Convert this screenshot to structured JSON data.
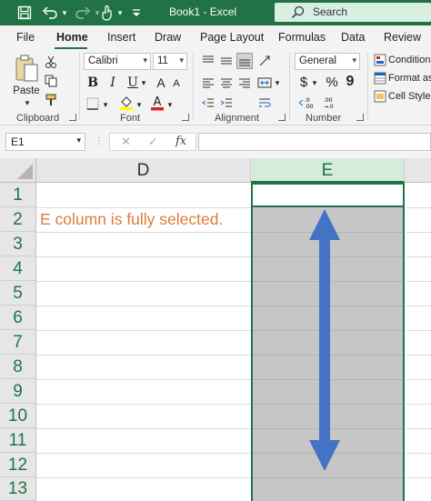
{
  "titlebar": {
    "title": "Book1  -  Excel",
    "search_placeholder": "Search",
    "icons": [
      "save-icon",
      "undo-icon",
      "redo-icon",
      "touch-mode-icon",
      "customize-qat-icon",
      "search-icon"
    ]
  },
  "tabs": [
    "File",
    "Home",
    "Insert",
    "Draw",
    "Page Layout",
    "Formulas",
    "Data",
    "Review"
  ],
  "active_tab": "Home",
  "ribbon": {
    "clipboard": {
      "paste_label": "Paste",
      "group_label": "Clipboard"
    },
    "font": {
      "font_name": "Calibri",
      "font_size": "11",
      "group_label": "Font",
      "bold": "B",
      "italic": "I",
      "underline": "U",
      "grow": "A",
      "shrink": "A"
    },
    "alignment": {
      "group_label": "Alignment"
    },
    "number": {
      "format": "General",
      "currency": "$",
      "percent": "%",
      "comma": "9",
      "group_label": "Number"
    },
    "styles": {
      "conditional": "Conditional",
      "format_as": "Format as",
      "cell_styles": "Cell Styles"
    }
  },
  "formula_bar": {
    "name_box": "E1",
    "fx_label": "fx",
    "cancel": "✕",
    "enter": "✓",
    "formula": ""
  },
  "grid": {
    "columns": [
      "D",
      "E"
    ],
    "selected_column": "E",
    "rows": [
      "1",
      "2",
      "3",
      "4",
      "5",
      "6",
      "7",
      "8",
      "9",
      "10",
      "11",
      "12",
      "13"
    ],
    "cells": {
      "D2": "E column is fully selected."
    }
  },
  "colors": {
    "brand": "#217346",
    "annotation_arrow": "#4472c4",
    "note_text": "#e07b39",
    "selection_fill": "#c6c6c6"
  }
}
